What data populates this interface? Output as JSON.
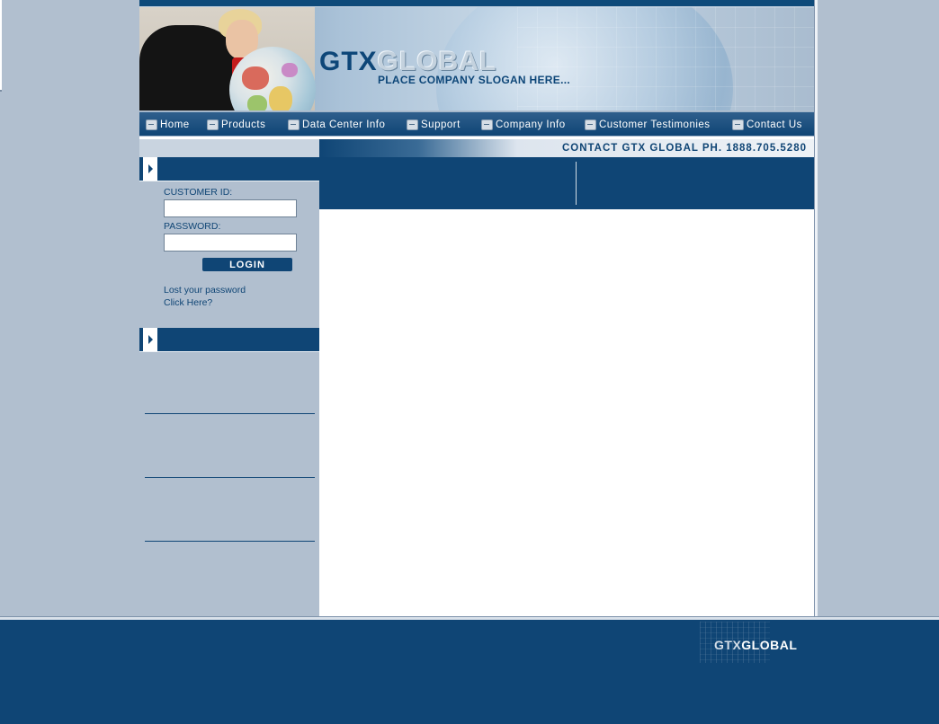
{
  "brand": {
    "logo_gtx": "GTX",
    "logo_global": "GLOBAL",
    "slogan": "PLACE COMPANY SLOGAN HERE..."
  },
  "nav": {
    "items": [
      {
        "label": "Home",
        "icon": "arrow-doc-icon"
      },
      {
        "label": "Products",
        "icon": "arrow-doc-icon"
      },
      {
        "label": "Data Center Info",
        "icon": "arrow-doc-icon"
      },
      {
        "label": "Support",
        "icon": "arrow-doc-icon"
      },
      {
        "label": "Company Info",
        "icon": "arrow-doc-icon"
      },
      {
        "label": "Customer Testimonies",
        "icon": "arrow-doc-icon"
      },
      {
        "label": "Contact Us",
        "icon": "arrow-doc-icon"
      }
    ]
  },
  "contact": {
    "text": "CONTACT GTX GLOBAL   PH. 1888.705.5280"
  },
  "login": {
    "customer_id_label": "CUSTOMER ID:",
    "customer_id_value": "",
    "password_label": "PASSWORD:",
    "password_value": "",
    "button_label": "LOGIN",
    "lost_password_line1": "Lost your password",
    "lost_password_line2": "Click Here?"
  },
  "footer": {
    "logo_gtx": "GTX",
    "logo_global": "GLOBAL"
  },
  "colors": {
    "primary": "#0f4575",
    "background": "#b1bfcf",
    "content_bg": "#ffffff"
  }
}
